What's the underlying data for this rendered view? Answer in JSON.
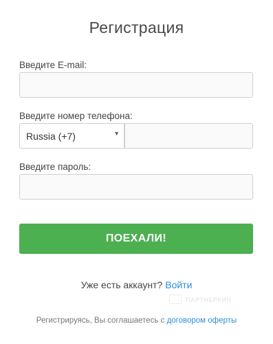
{
  "title": "Регистрация",
  "email": {
    "label": "Введите E-mail:",
    "value": ""
  },
  "phone": {
    "label": "Введите номер телефона:",
    "country_selected": "Russia (+7)",
    "value": ""
  },
  "password": {
    "label": "Введите пароль:",
    "value": ""
  },
  "submit_label": "ПОЕХАЛИ!",
  "account_prompt": "Уже есть аккаунт?",
  "login_link": "Войти",
  "terms_text": "Регистрируясь, Вы соглашаетесь с",
  "terms_link": "договором оферты",
  "watermark_text": "ПАРТНЕРКИН",
  "colors": {
    "button": "#4caf50",
    "link": "#2a8fd8"
  },
  "icons": {
    "select_caret": "caret-down-icon",
    "watermark": "chat-bubble-icon"
  }
}
